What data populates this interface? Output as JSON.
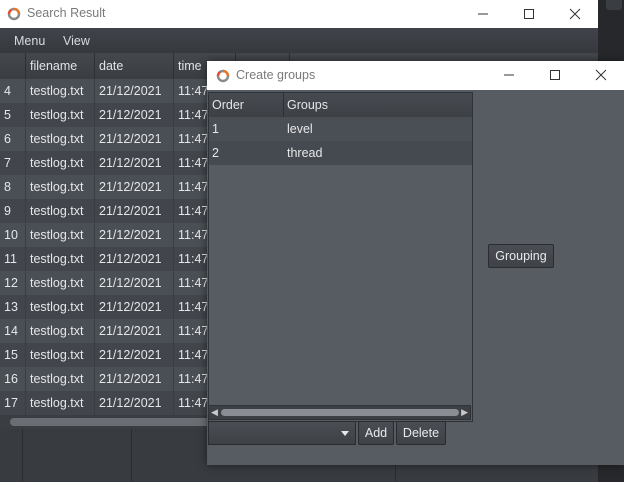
{
  "search_window": {
    "title": "Search Result",
    "menu": [
      "Menu",
      "View"
    ],
    "columns": [
      "",
      "filename",
      "date",
      "time"
    ],
    "rows": [
      {
        "num": "4",
        "filename": "testlog.txt",
        "date": "21/12/2021",
        "time": "11:47:"
      },
      {
        "num": "5",
        "filename": "testlog.txt",
        "date": "21/12/2021",
        "time": "11:47:"
      },
      {
        "num": "6",
        "filename": "testlog.txt",
        "date": "21/12/2021",
        "time": "11:47:"
      },
      {
        "num": "7",
        "filename": "testlog.txt",
        "date": "21/12/2021",
        "time": "11:47:"
      },
      {
        "num": "8",
        "filename": "testlog.txt",
        "date": "21/12/2021",
        "time": "11:47:"
      },
      {
        "num": "9",
        "filename": "testlog.txt",
        "date": "21/12/2021",
        "time": "11:47:"
      },
      {
        "num": "10",
        "filename": "testlog.txt",
        "date": "21/12/2021",
        "time": "11:47:"
      },
      {
        "num": "11",
        "filename": "testlog.txt",
        "date": "21/12/2021",
        "time": "11:47:"
      },
      {
        "num": "12",
        "filename": "testlog.txt",
        "date": "21/12/2021",
        "time": "11:47:"
      },
      {
        "num": "13",
        "filename": "testlog.txt",
        "date": "21/12/2021",
        "time": "11:47:"
      },
      {
        "num": "14",
        "filename": "testlog.txt",
        "date": "21/12/2021",
        "time": "11:47:"
      },
      {
        "num": "15",
        "filename": "testlog.txt",
        "date": "21/12/2021",
        "time": "11:47:"
      },
      {
        "num": "16",
        "filename": "testlog.txt",
        "date": "21/12/2021",
        "time": "11:47:"
      },
      {
        "num": "17",
        "filename": "testlog.txt",
        "date": "21/12/2021",
        "time": "11:47:"
      }
    ]
  },
  "groups_dialog": {
    "title": "Create groups",
    "columns": [
      "Order",
      "Groups"
    ],
    "rows": [
      {
        "order": "1",
        "group": "level"
      },
      {
        "order": "2",
        "group": "thread"
      }
    ],
    "grouping_label": "Grouping",
    "add_label": "Add",
    "delete_label": "Delete",
    "select_value": ""
  },
  "icons": {
    "app": "app-ring-icon",
    "minimize": "minimize-icon",
    "maximize": "maximize-icon",
    "close": "close-icon",
    "dropdown": "chevron-down-icon"
  },
  "colors": {
    "app_icon_orange": "#e8752a",
    "app_icon_gray": "#8a8a8a",
    "window_bg": "#575c63"
  }
}
